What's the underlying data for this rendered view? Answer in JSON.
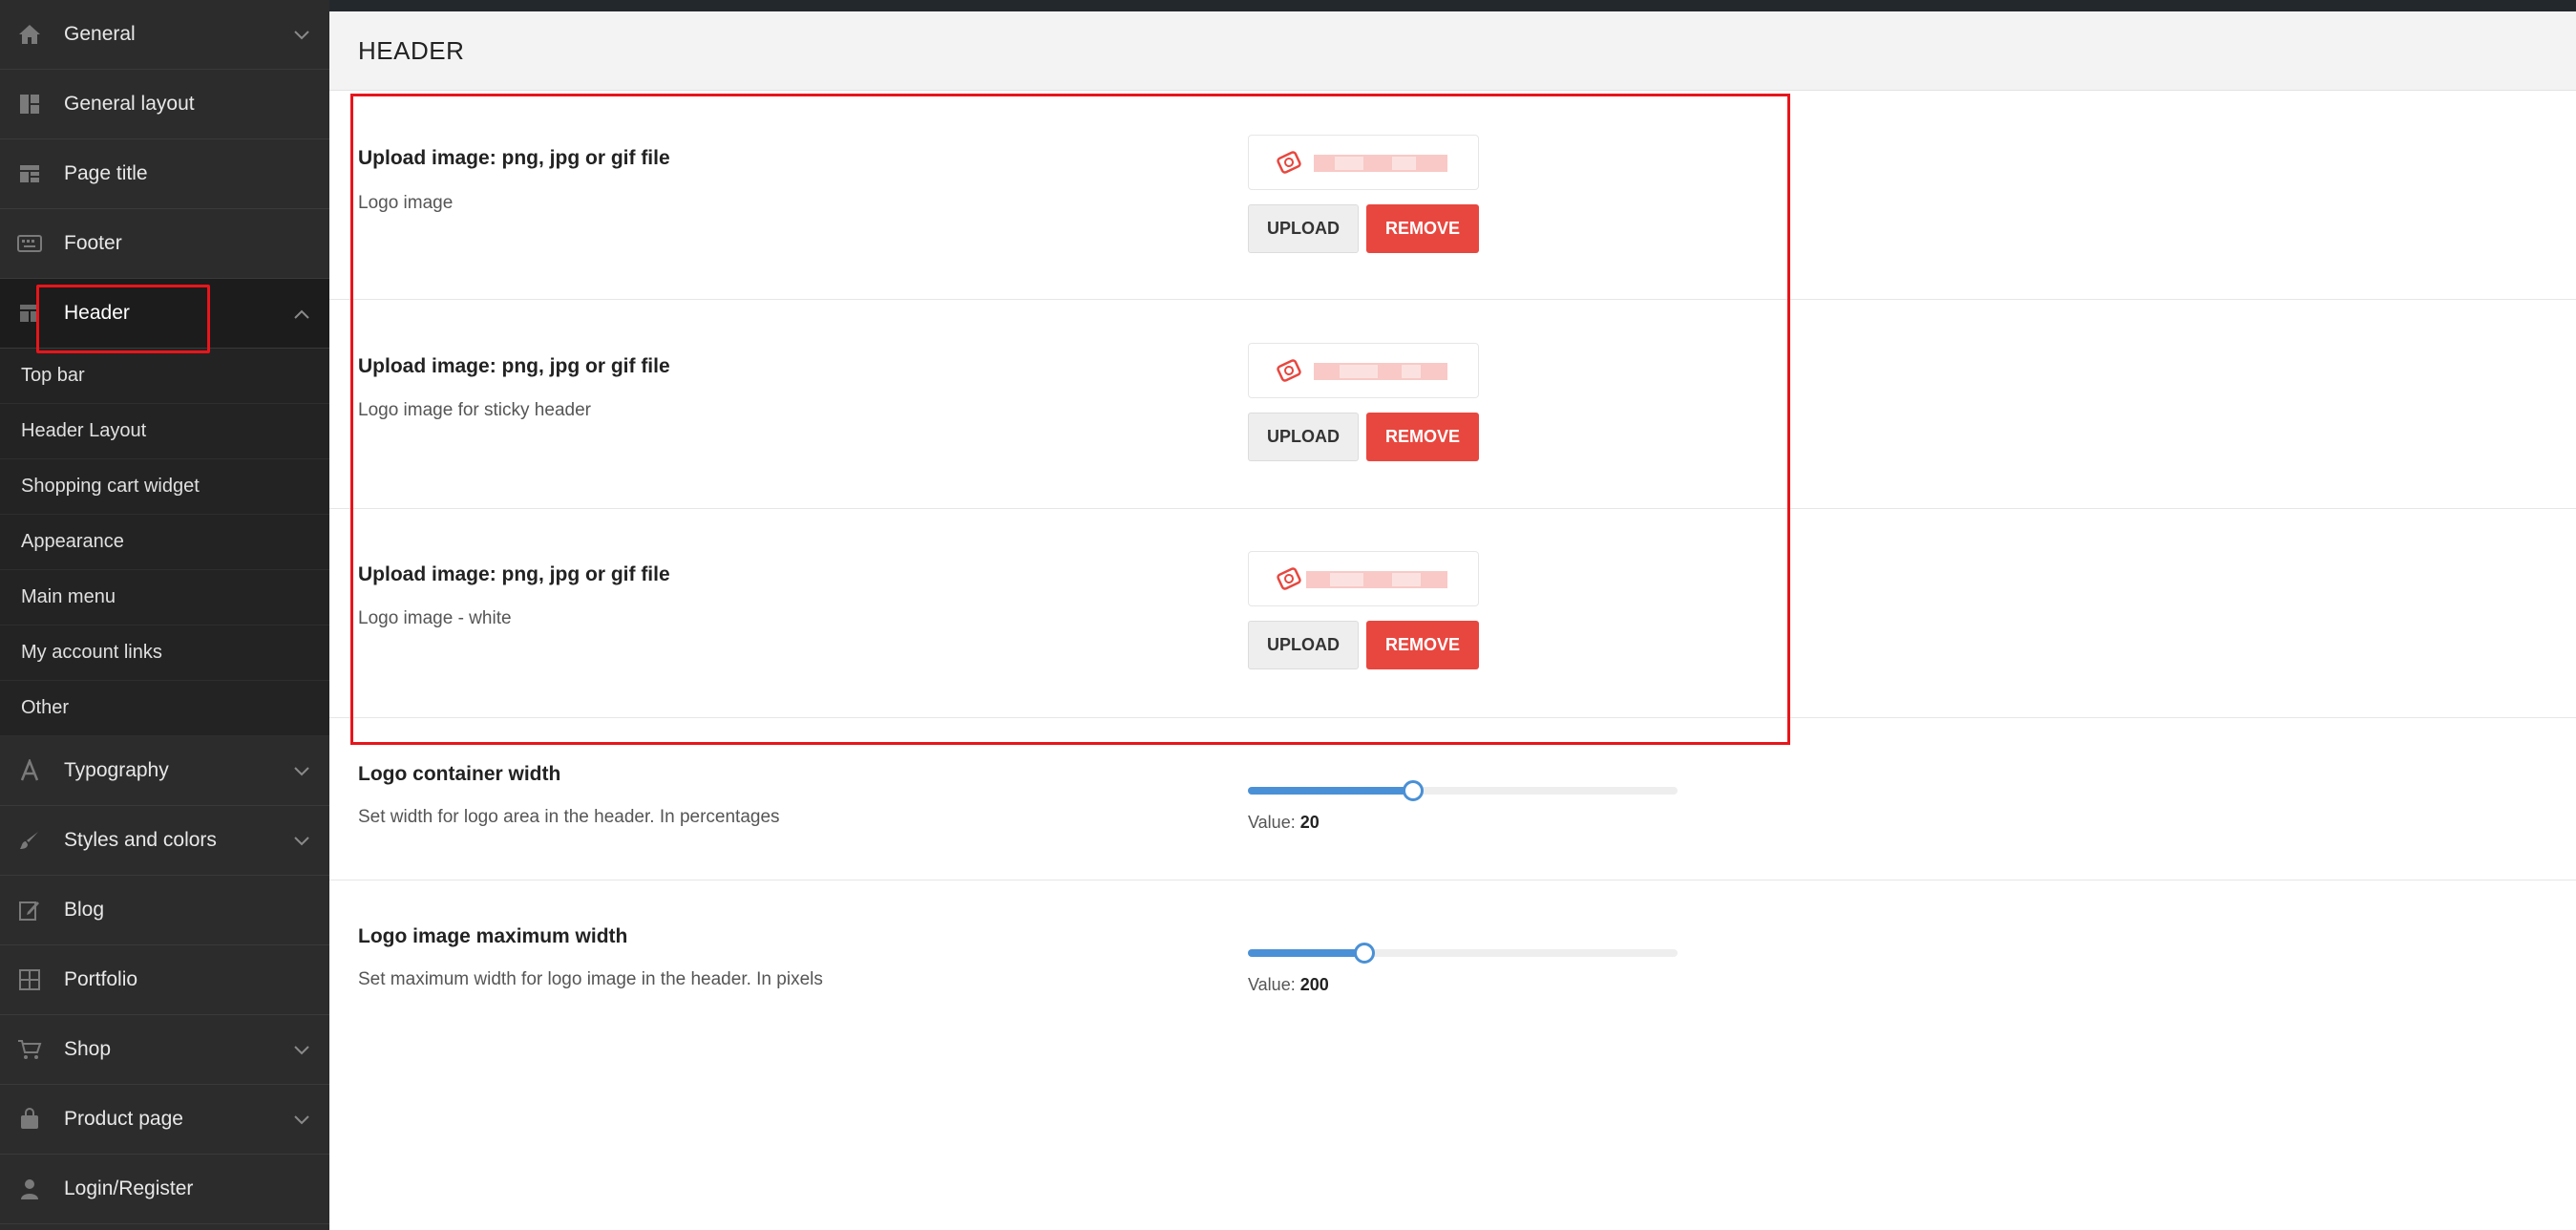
{
  "sidebar": {
    "items_top": [
      {
        "label": "General",
        "icon": "home-icon",
        "has_chevron": true
      },
      {
        "label": "General layout",
        "icon": "layout-grid-icon",
        "has_chevron": false
      },
      {
        "label": "Page title",
        "icon": "page-title-icon",
        "has_chevron": false
      },
      {
        "label": "Footer",
        "icon": "keyboard-icon",
        "has_chevron": false
      }
    ],
    "active_item": {
      "label": "Header",
      "icon": "header-layout-icon"
    },
    "submenu": [
      "Top bar",
      "Header Layout",
      "Shopping cart widget",
      "Appearance",
      "Main menu",
      "My account links",
      "Other"
    ],
    "items_bottom": [
      {
        "label": "Typography",
        "icon": "typography-icon",
        "has_chevron": true
      },
      {
        "label": "Styles and colors",
        "icon": "brush-icon",
        "has_chevron": true
      },
      {
        "label": "Blog",
        "icon": "edit-icon",
        "has_chevron": false
      },
      {
        "label": "Portfolio",
        "icon": "grid-icon",
        "has_chevron": false
      },
      {
        "label": "Shop",
        "icon": "cart-icon",
        "has_chevron": true
      },
      {
        "label": "Product page",
        "icon": "bag-icon",
        "has_chevron": true
      },
      {
        "label": "Login/Register",
        "icon": "user-icon",
        "has_chevron": false
      }
    ]
  },
  "main": {
    "section_title": "HEADER",
    "uploads": [
      {
        "title": "Upload image: png, jpg or gif file",
        "description": "Logo image",
        "upload_label": "UPLOAD",
        "remove_label": "REMOVE"
      },
      {
        "title": "Upload image: png, jpg or gif file",
        "description": "Logo image for sticky header",
        "upload_label": "UPLOAD",
        "remove_label": "REMOVE"
      },
      {
        "title": "Upload image: png, jpg or gif file",
        "description": "Logo image - white",
        "upload_label": "UPLOAD",
        "remove_label": "REMOVE"
      }
    ],
    "sliders": [
      {
        "title": "Logo container width",
        "description": "Set width for logo area in the header. In percentages",
        "value_prefix": "Value:",
        "value": "20",
        "fill_fraction": 0.385
      },
      {
        "title": "Logo image maximum width",
        "description": "Set maximum width for logo image in the header. In pixels",
        "value_prefix": "Value:",
        "value": "200",
        "fill_fraction": 0.27
      }
    ]
  },
  "colors": {
    "sidebar_bg": "#2c2c2c",
    "accent_red": "#e8473f",
    "highlight_red": "#e8151b",
    "slider_blue": "#4a90d6"
  }
}
